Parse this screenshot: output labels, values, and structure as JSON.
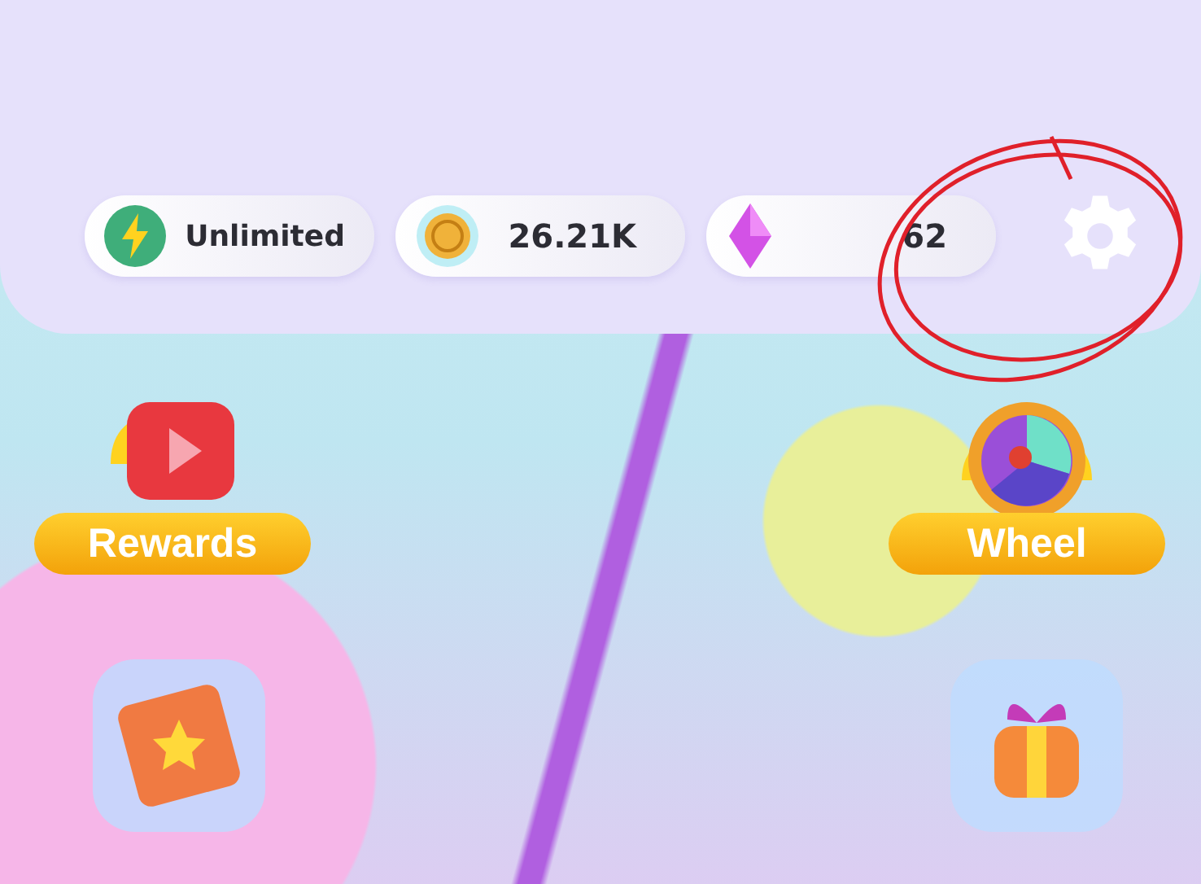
{
  "resources": [
    {
      "kind": "energy",
      "value": "Unlimited"
    },
    {
      "kind": "coin",
      "value": "26.21K"
    },
    {
      "kind": "gem",
      "value": "62"
    }
  ],
  "feature_buttons": [
    {
      "kind": "video",
      "label": "Rewards"
    },
    {
      "kind": "wheel",
      "label": "Wheel"
    }
  ],
  "icon_buttons": [
    {
      "kind": "book"
    },
    {
      "kind": "gift"
    }
  ]
}
